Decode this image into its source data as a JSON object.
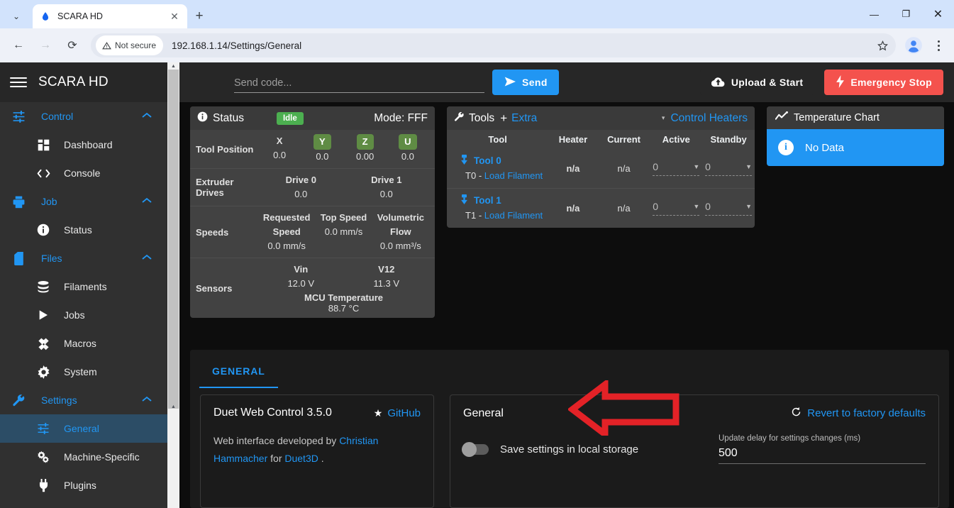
{
  "browser": {
    "tab": {
      "title": "SCARA HD",
      "favicon": "water-drop-icon",
      "close": "✕"
    },
    "new_tab": "+",
    "tab_list_chevron": "⌄",
    "window_controls": {
      "minimize": "—",
      "maximize": "❐",
      "close": "✕"
    },
    "nav": {
      "back": "←",
      "forward": "→",
      "reload": "⟳"
    },
    "security_label": "Not secure",
    "url": "192.168.1.14/Settings/General",
    "bookmark_icon": "star-icon",
    "profile_icon": "profile-avatar-icon",
    "menu_icon": "kebab-menu-icon"
  },
  "sidebar": {
    "brand": "SCARA HD",
    "groups": [
      {
        "label": "Control",
        "icon": "sliders-icon",
        "chevron": "⌃",
        "items": [
          {
            "label": "Dashboard",
            "icon": "dashboard-icon"
          },
          {
            "label": "Console",
            "icon": "code-brackets-icon"
          }
        ]
      },
      {
        "label": "Job",
        "icon": "printer-icon",
        "chevron": "⌃",
        "items": [
          {
            "label": "Status",
            "icon": "info-icon"
          }
        ]
      },
      {
        "label": "Files",
        "icon": "sd-card-icon",
        "chevron": "⌃",
        "items": [
          {
            "label": "Filaments",
            "icon": "database-icon"
          },
          {
            "label": "Jobs",
            "icon": "play-icon"
          },
          {
            "label": "Macros",
            "icon": "macros-icon"
          },
          {
            "label": "System",
            "icon": "gear-icon"
          }
        ]
      },
      {
        "label": "Settings",
        "icon": "wrench-icon",
        "chevron": "⌃",
        "items": [
          {
            "label": "General",
            "icon": "sliders-icon",
            "active": true
          },
          {
            "label": "Machine-Specific",
            "icon": "gears-icon"
          },
          {
            "label": "Plugins",
            "icon": "plug-icon"
          }
        ]
      }
    ]
  },
  "topbar": {
    "send_placeholder": "Send code...",
    "send_label": "Send",
    "send_icon": "send-arrow-icon",
    "upload_label": "Upload & Start",
    "upload_icon": "cloud-upload-icon",
    "estop_label": "Emergency Stop",
    "estop_icon": "lightning-bolt-icon"
  },
  "status": {
    "title": "Status",
    "title_icon": "info-icon",
    "badge": "Idle",
    "mode": "Mode: FFF",
    "tool_position": {
      "label": "Tool Position",
      "axes": [
        {
          "name": "X",
          "value": "0.0",
          "highlighted": false
        },
        {
          "name": "Y",
          "value": "0.0",
          "highlighted": true
        },
        {
          "name": "Z",
          "value": "0.00",
          "highlighted": true
        },
        {
          "name": "U",
          "value": "0.0",
          "highlighted": true
        }
      ]
    },
    "extruder_drives": {
      "label": "Extruder Drives",
      "drives": [
        {
          "name": "Drive 0",
          "value": "0.0"
        },
        {
          "name": "Drive 1",
          "value": "0.0"
        }
      ]
    },
    "speeds": {
      "label": "Speeds",
      "items": [
        {
          "name": "Requested Speed",
          "value": "0.0 mm/s"
        },
        {
          "name": "Top Speed",
          "value": "0.0 mm/s"
        },
        {
          "name": "Volumetric Flow",
          "value": "0.0 mm³/s"
        }
      ]
    },
    "sensors": {
      "label": "Sensors",
      "items": [
        {
          "name": "Vin",
          "value": "12.0 V"
        },
        {
          "name": "V12",
          "value": "11.3 V"
        }
      ],
      "mcu_label": "MCU Temperature",
      "mcu_value": "88.7 °C"
    }
  },
  "tools": {
    "title": "Tools",
    "title_icon": "wrench-icon",
    "plus": "+",
    "extra_label": "Extra",
    "caret": "▾",
    "control_heaters_label": "Control Heaters",
    "columns": [
      "Tool",
      "Heater",
      "Current",
      "Active",
      "Standby"
    ],
    "rows": [
      {
        "tool": "Tool 0",
        "tool_icon": "tool-pin-icon",
        "sub_prefix": "T0 - ",
        "sub_link": "Load Filament",
        "heater": "n/a",
        "current": "n/a",
        "active": "0",
        "standby": "0"
      },
      {
        "tool": "Tool 1",
        "tool_icon": "tool-pin-icon",
        "sub_prefix": "T1 - ",
        "sub_link": "Load Filament",
        "heater": "n/a",
        "current": "n/a",
        "active": "0",
        "standby": "0"
      }
    ]
  },
  "temperature_chart": {
    "title": "Temperature Chart",
    "title_icon": "line-chart-icon",
    "alert_icon": "info-icon",
    "alert_text": "No Data"
  },
  "settings": {
    "tab_label": "GENERAL",
    "about_card": {
      "title": "Duet Web Control 3.5.0",
      "github_label": "GitHub",
      "github_icon": "star-icon",
      "body_prefix": "Web interface developed by ",
      "author": "Christian Hammacher",
      "body_middle": " for ",
      "company": "Duet3D",
      "body_suffix": " ."
    },
    "general_card": {
      "title": "General",
      "revert_label": "Revert to factory defaults",
      "revert_icon": "undo-icon",
      "toggle_label": "Save settings in local storage",
      "toggle_on": false,
      "field_label": "Update delay for settings changes (ms)",
      "field_value": "500"
    }
  },
  "annotation": {
    "arrow": "left-pointing-red-arrow",
    "color": "#e32227"
  },
  "colors": {
    "accent_blue": "#2196f3",
    "danger_red": "#f4524d",
    "success_green": "#4caf50",
    "panel_gray": "#424242",
    "sidebar_gray": "#303030",
    "annotation_red": "#e32227"
  }
}
